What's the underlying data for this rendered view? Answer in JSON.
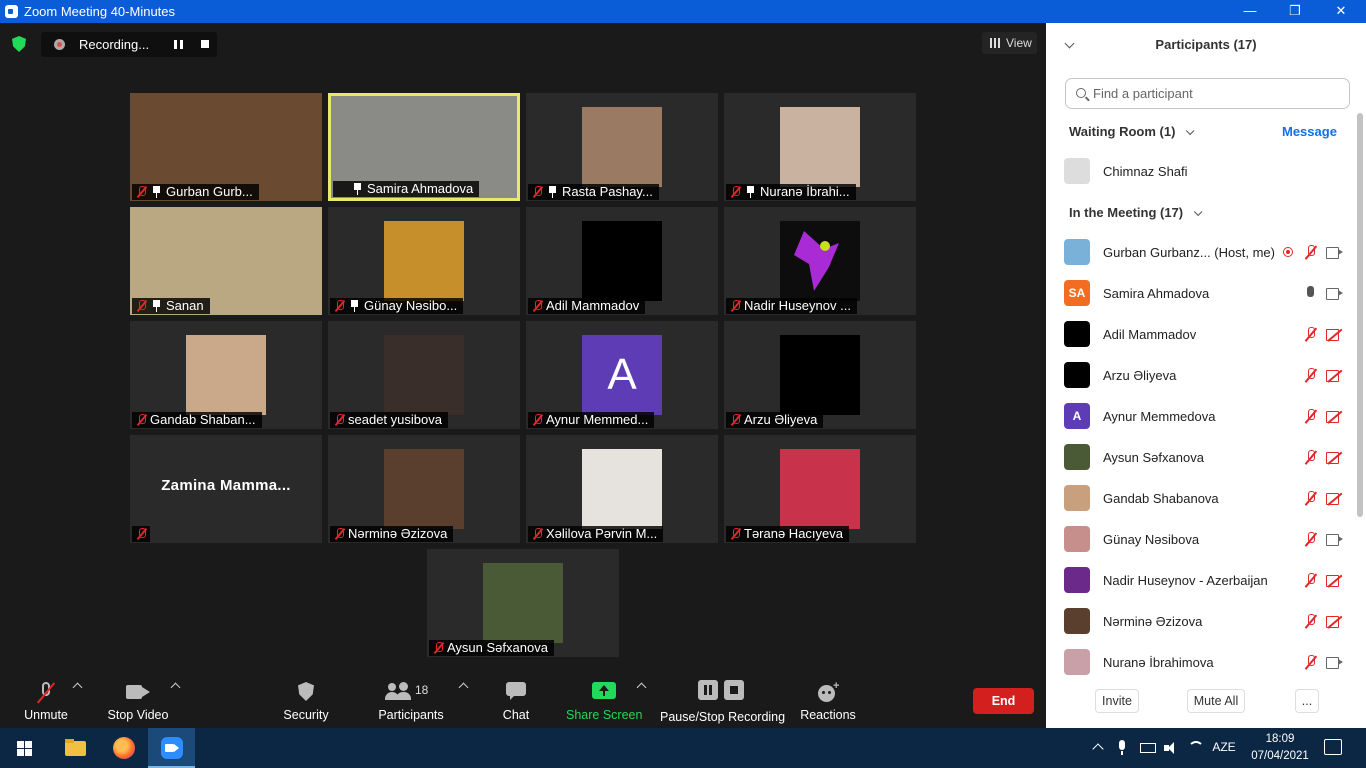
{
  "window": {
    "title": "Zoom Meeting 40-Minutes",
    "minimize": "—",
    "restore": "❐",
    "close": "✕"
  },
  "recording": {
    "label": "Recording..."
  },
  "view": {
    "label": "View"
  },
  "tiles": [
    {
      "name": "Gurban Gurb...",
      "muted": true,
      "pinned": true,
      "bg": "#6b4a32"
    },
    {
      "name": "Samira Ahmadova",
      "muted": false,
      "pinned": true,
      "bg": "#8a8a86",
      "active": true
    },
    {
      "name": "Rasta Pashay...",
      "muted": true,
      "pinned": true,
      "bg": "#9a7a62"
    },
    {
      "name": "Nuranə İbrahi...",
      "muted": true,
      "pinned": true,
      "bg": "#c9b3a0"
    },
    {
      "name": "Sanan",
      "muted": true,
      "pinned": true,
      "bg": "#b9a882"
    },
    {
      "name": "Günay Nəsibo...",
      "muted": true,
      "pinned": true,
      "bg": "#c78f2c"
    },
    {
      "name": "Adil Mammadov",
      "muted": true,
      "pinned": false,
      "bg": "#000000"
    },
    {
      "name": "Nadir Huseynov ...",
      "muted": true,
      "pinned": false,
      "bg": "#0d0d0d",
      "icon": "purple-flower"
    },
    {
      "name": "Gandab Shaban...",
      "muted": true,
      "pinned": false,
      "bg": "#caa88a"
    },
    {
      "name": "seadet yusibova",
      "muted": true,
      "pinned": false,
      "bg": "#3a2e2a"
    },
    {
      "name": "Aynur Memmed...",
      "muted": true,
      "pinned": false,
      "bg": "#5d3cb5",
      "letter": "A"
    },
    {
      "name": "Arzu Əliyeva",
      "muted": true,
      "pinned": false,
      "bg": "#000000"
    },
    {
      "name": "",
      "muted": true,
      "pinned": false,
      "bigname": "Zamina  Mamma..."
    },
    {
      "name": "Nərminə Əzizova",
      "muted": true,
      "pinned": false,
      "bg": "#5a3e2e"
    },
    {
      "name": "Xəlilova Pərvin M...",
      "muted": true,
      "pinned": false,
      "bg": "#e6e2de"
    },
    {
      "name": "Təranə Hacıyeva",
      "muted": true,
      "pinned": false,
      "bg": "#c8324a"
    },
    {
      "name": "Aysun Səfxanova",
      "muted": true,
      "pinned": false,
      "bg": "#4a5a36"
    }
  ],
  "toolbar": {
    "unmute": "Unmute",
    "stop_video": "Stop Video",
    "security": "Security",
    "participants": "Participants",
    "participants_count": "18",
    "chat": "Chat",
    "share_screen": "Share Screen",
    "pause_stop_recording": "Pause/Stop Recording",
    "reactions": "Reactions",
    "end": "End"
  },
  "panel": {
    "title": "Participants (17)",
    "search_placeholder": "Find a participant",
    "waiting_room": "Waiting Room (1)",
    "message": "Message",
    "waiting": [
      {
        "name": "Chimnaz Shafi"
      }
    ],
    "in_meeting": "In the Meeting (17)",
    "participants": [
      {
        "name": "Gurban Gurbanz...  (Host, me)",
        "avatar": "#7ab1d8",
        "mic": "off",
        "cam": "on",
        "rec": true
      },
      {
        "name": "Samira Ahmadova",
        "avatar": "#f26d21",
        "initials": "SA",
        "mic": "on",
        "cam": "on"
      },
      {
        "name": "Adil Mammadov",
        "avatar": "#000000",
        "mic": "off",
        "cam": "off"
      },
      {
        "name": "Arzu Əliyeva",
        "avatar": "#000000",
        "mic": "off",
        "cam": "off"
      },
      {
        "name": "Aynur Memmedova",
        "avatar": "#5d3cb5",
        "initials": "A",
        "mic": "off",
        "cam": "off"
      },
      {
        "name": "Aysun Səfxanova",
        "avatar": "#4a5a36",
        "mic": "off",
        "cam": "off"
      },
      {
        "name": "Gandab Shabanova",
        "avatar": "#c9a07e",
        "mic": "off",
        "cam": "off"
      },
      {
        "name": "Günay Nəsibova",
        "avatar": "#c78f8c",
        "mic": "off",
        "cam": "on"
      },
      {
        "name": "Nadir Huseynov - Azerbaijan",
        "avatar": "#6b2a8a",
        "mic": "off",
        "cam": "off"
      },
      {
        "name": "Nərminə Əzizova",
        "avatar": "#5a3e2e",
        "mic": "off",
        "cam": "off"
      },
      {
        "name": "Nuranə İbrahimova",
        "avatar": "#c9a0a8",
        "mic": "off",
        "cam": "on"
      }
    ],
    "invite": "Invite",
    "mute_all": "Mute All",
    "more": "..."
  },
  "taskbar": {
    "lang": "AZE",
    "time": "18:09",
    "date": "07/04/2021"
  }
}
